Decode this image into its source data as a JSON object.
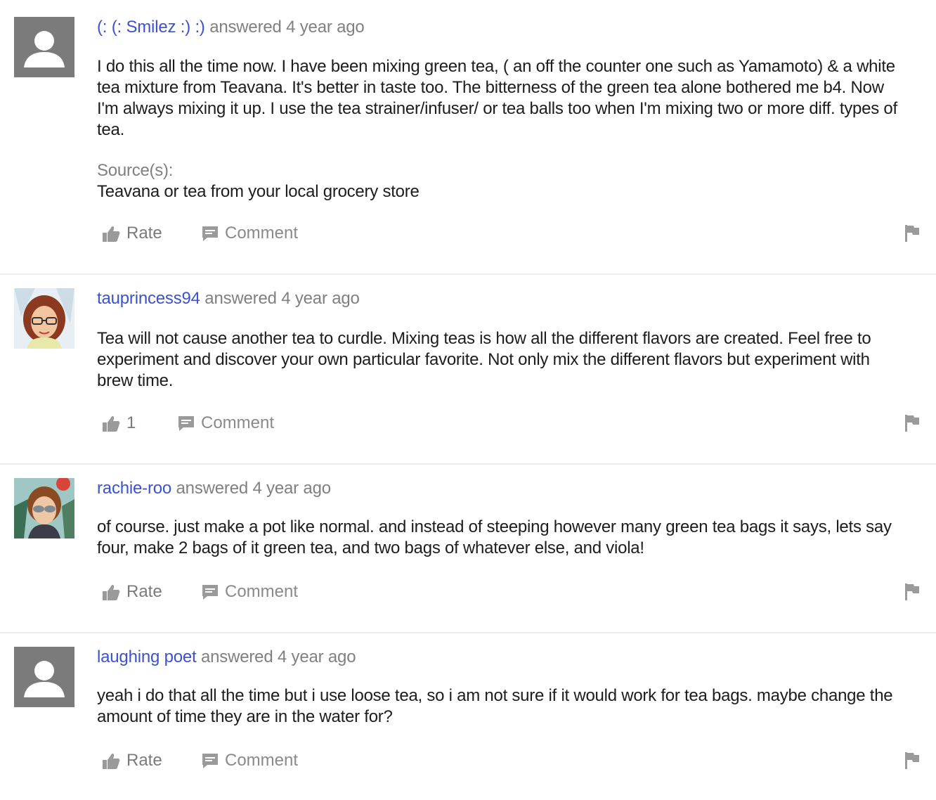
{
  "answers": [
    {
      "author": "(: (: Smilez :) :)",
      "answered": "answered 4 year ago",
      "paragraphs": [
        "I do this all the time now. I have been mixing green tea, ( an off the counter one such as Yamamoto) & a white",
        "tea mixture from Teavana. It's better in taste too. The bitterness of the green tea alone bothered me b4. Now",
        "I'm always mixing it up. I use the tea strainer/infuser/ or tea balls too when I'm mixing two or more diff. types of",
        "tea."
      ],
      "source_label": "Source(s):",
      "source_text": "Teavana or tea from your local grocery store",
      "rate_label": "Rate",
      "comment_label": "Comment"
    },
    {
      "author": "tauprincess94",
      "answered": "answered 4 year ago",
      "paragraphs": [
        "Tea will not cause another tea to curdle. Mixing teas is how all the different flavors are created. Feel free to",
        "experiment and discover your own particular favorite. Not only mix the different flavors but experiment with",
        "brew time."
      ],
      "rate_label": "1",
      "comment_label": "Comment"
    },
    {
      "author": "rachie-roo",
      "answered": "answered 4 year ago",
      "paragraphs": [
        "of course. just make a pot like normal. and instead of steeping however many green tea bags it says, lets say",
        "four, make 2 bags of it green tea, and two bags of whatever else, and viola!"
      ],
      "rate_label": "Rate",
      "comment_label": "Comment"
    },
    {
      "author": "laughing poet",
      "answered": "answered 4 year ago",
      "paragraphs": [
        "yeah i do that all the time but i use loose tea, so i am not sure if it would work for tea bags. maybe change the",
        "amount of time they are in the water for?"
      ],
      "rate_label": "Rate",
      "comment_label": "Comment"
    }
  ],
  "icons": {
    "thumb": "thumbs-up-icon",
    "comment": "comment-icon",
    "flag": "flag-icon",
    "default_avatar": "default-user-avatar"
  },
  "colors": {
    "author_link": "#3c52d0",
    "muted": "#808080",
    "icon_gray": "#9a9a9a",
    "separator": "#ececec"
  }
}
